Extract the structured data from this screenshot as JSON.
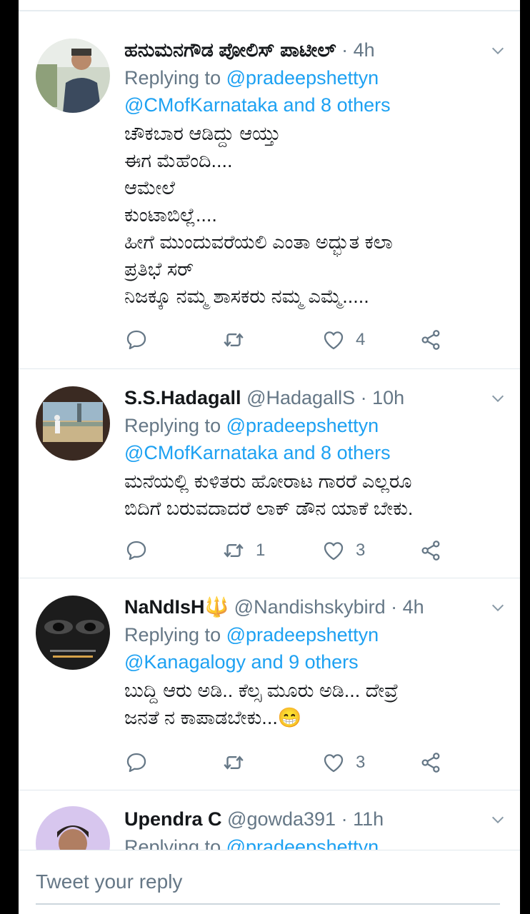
{
  "tweets": [
    {
      "name": "ಹನುಮನಗೌಡ ಪೋಲಿಸ್ ಪಾಟೀಲ್",
      "handle": "",
      "time": "· 4h",
      "replying_prefix": "Replying to ",
      "reply_primary": "@pradeepshettyn",
      "reply_secondary": "@CMofKarnataka and 8 others",
      "text_lines": [
        "ಚೌಕಬಾರ ಆಡಿದ್ದು ಆಯ್ತು",
        "ಈಗ ಮೆಹೆಂದಿ....",
        "ಆಮೇಲೆ",
        "ಕುಂಟಾಬಿಲ್ಲೆ....",
        "ಹೀಗೆ ಮುಂದುವರೆಯಲಿ ಎಂತಾ ಅದ್ಭುತ ಕಲಾ",
        "ಪ್ರತಿಭೆ ಸರ್",
        "ನಿಜಕ್ಕೂ ನಮ್ಮ ಶಾಸಕರು ನಮ್ಮ ಎಮ್ಮೆ....."
      ],
      "retweets": "",
      "likes": "4"
    },
    {
      "name": "S.S.Hadagall",
      "handle": "@HadagallS",
      "time": "· 10h",
      "replying_prefix": "Replying to ",
      "reply_primary": "@pradeepshettyn",
      "reply_secondary": "@CMofKarnataka and 8 others",
      "text_lines": [
        "ಮನೆಯಲ್ಲಿ ಕುಳಿತರು ಹೋರಾಟ ಗಾರರೆ ಎಲ್ಲರೂ",
        "ಬಿದಿಗೆ ಬರುವದಾದರೆ ಲಾಕ್ ಡೌನ ಯಾಕೆ ಬೇಕು."
      ],
      "retweets": "1",
      "likes": "3"
    },
    {
      "name": "NaNdIsH🔱",
      "handle": "@Nandishskybird",
      "time": "· 4h",
      "replying_prefix": "Replying to ",
      "reply_primary": "@pradeepshettyn",
      "reply_secondary": "@Kanagalogy and 9 others",
      "text_lines": [
        "ಬುದ್ದಿ ಆರು ಅಡಿ.. ಕೆಲ್ಸ ಮೂರು ಅಡಿ... ದೇವ್ರೆ",
        "ಜನತೆ ನ ಕಾಪಾಡಬೇಕು...😁"
      ],
      "retweets": "",
      "likes": "3"
    },
    {
      "name": "Upendra C",
      "handle": "@gowda391",
      "time": "· 11h",
      "replying_prefix": "Replying to ",
      "reply_primary": "@pradeepshettyn"
    }
  ],
  "composer": {
    "placeholder": "Tweet your reply"
  },
  "colors": {
    "accent": "#1da1f2",
    "secondary_text": "#657786",
    "primary_text": "#14171a"
  },
  "icons": [
    "reply-icon",
    "retweet-icon",
    "like-icon",
    "share-icon",
    "chevron-down-icon"
  ]
}
